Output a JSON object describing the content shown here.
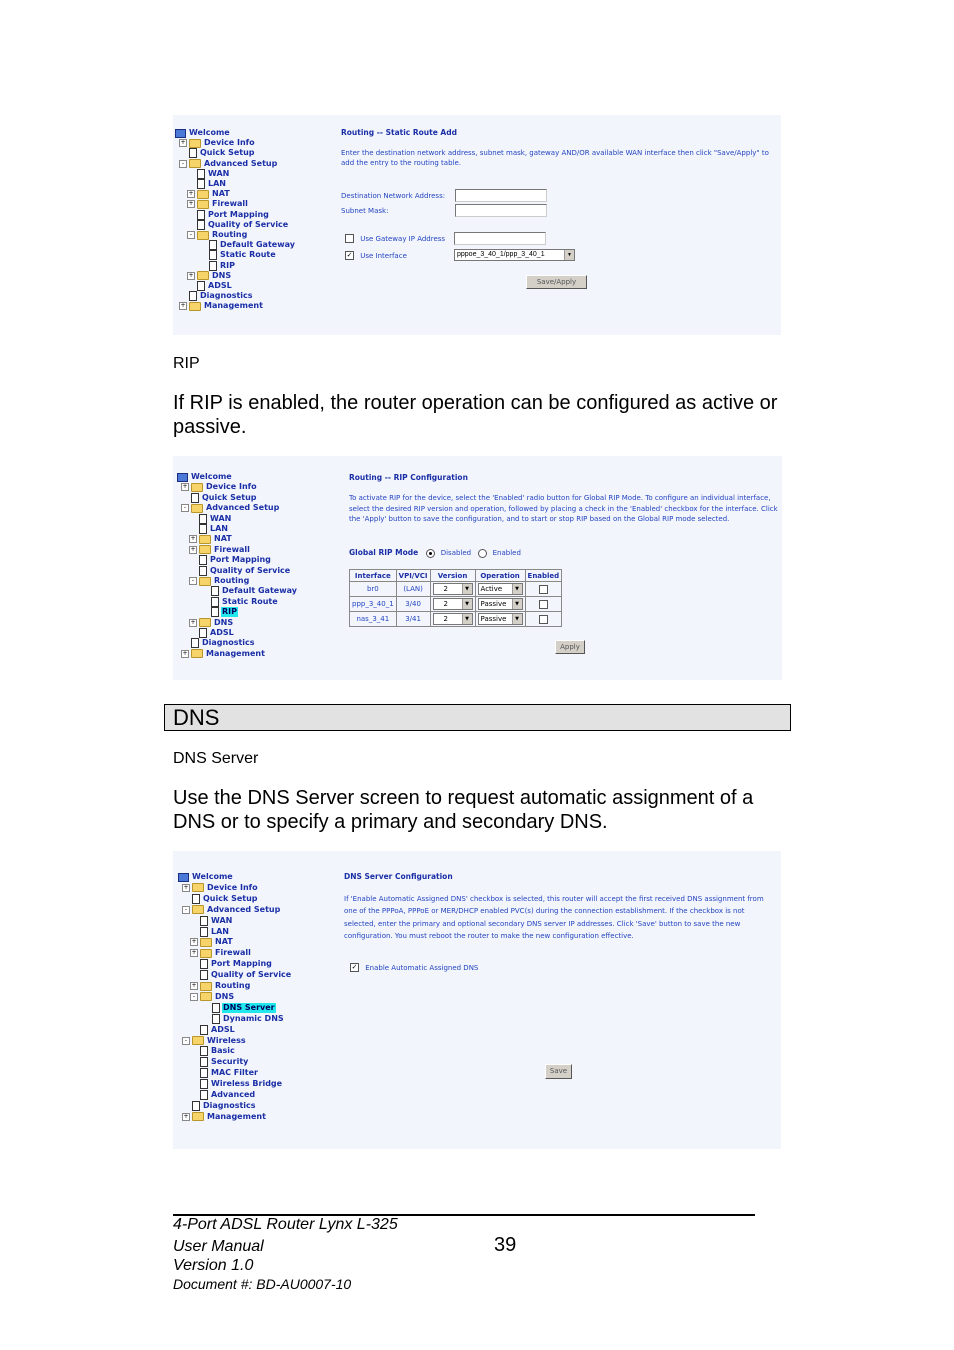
{
  "screenshot1": {
    "tree": [
      {
        "label": "Welcome",
        "icon": "monitor-icon",
        "level": 0
      },
      {
        "label": "Device Info",
        "icon": "folder-icon",
        "level": 0,
        "expander": "+"
      },
      {
        "label": "Quick Setup",
        "icon": "page-icon",
        "level": 0
      },
      {
        "label": "Advanced Setup",
        "icon": "folder-open-icon",
        "level": 0,
        "expander": "-"
      },
      {
        "label": "WAN",
        "icon": "page-icon",
        "level": 1
      },
      {
        "label": "LAN",
        "icon": "page-icon",
        "level": 1
      },
      {
        "label": "NAT",
        "icon": "folder-icon",
        "level": 1,
        "expander": "+"
      },
      {
        "label": "Firewall",
        "icon": "folder-icon",
        "level": 1,
        "expander": "+"
      },
      {
        "label": "Port Mapping",
        "icon": "page-icon",
        "level": 1
      },
      {
        "label": "Quality of Service",
        "icon": "page-icon",
        "level": 1
      },
      {
        "label": "Routing",
        "icon": "folder-open-icon",
        "level": 1,
        "expander": "-"
      },
      {
        "label": "Default Gateway",
        "icon": "page-icon",
        "level": 2
      },
      {
        "label": "Static Route",
        "icon": "page-icon",
        "level": 2
      },
      {
        "label": "RIP",
        "icon": "page-icon",
        "level": 2
      },
      {
        "label": "DNS",
        "icon": "folder-icon",
        "level": 1,
        "expander": "+"
      },
      {
        "label": "ADSL",
        "icon": "page-icon",
        "level": 1
      },
      {
        "label": "Diagnostics",
        "icon": "page-icon",
        "level": 0
      },
      {
        "label": "Management",
        "icon": "folder-icon",
        "level": 0,
        "expander": "+"
      }
    ],
    "title": "Routing -- Static Route Add",
    "description": "Enter the destination network address, subnet mask, gateway AND/OR available WAN interface then click \"Save/Apply\" to add the entry to the routing table.",
    "dest_label": "Destination Network Address:",
    "dest_value": "",
    "mask_label": "Subnet Mask:",
    "mask_value": "",
    "gateway_label": "Use Gateway IP Address",
    "gateway_checked": false,
    "gateway_value": "",
    "interface_label": "Use Interface",
    "interface_checked": true,
    "interface_value": "pppoe_3_40_1/ppp_3_40_1",
    "save_button": "Save/Apply"
  },
  "rip_heading": "RIP",
  "rip_paragraph": "If RIP is enabled, the router operation can be configured as active or passive.",
  "screenshot2": {
    "tree": [
      {
        "label": "Welcome",
        "icon": "monitor-icon",
        "level": 0
      },
      {
        "label": "Device Info",
        "icon": "folder-icon",
        "level": 0,
        "expander": "+"
      },
      {
        "label": "Quick Setup",
        "icon": "page-icon",
        "level": 0
      },
      {
        "label": "Advanced Setup",
        "icon": "folder-open-icon",
        "level": 0,
        "expander": "-"
      },
      {
        "label": "WAN",
        "icon": "page-icon",
        "level": 1
      },
      {
        "label": "LAN",
        "icon": "page-icon",
        "level": 1
      },
      {
        "label": "NAT",
        "icon": "folder-icon",
        "level": 1,
        "expander": "+"
      },
      {
        "label": "Firewall",
        "icon": "folder-icon",
        "level": 1,
        "expander": "+"
      },
      {
        "label": "Port Mapping",
        "icon": "page-icon",
        "level": 1
      },
      {
        "label": "Quality of Service",
        "icon": "page-icon",
        "level": 1
      },
      {
        "label": "Routing",
        "icon": "folder-open-icon",
        "level": 1,
        "expander": "-"
      },
      {
        "label": "Default Gateway",
        "icon": "page-icon",
        "level": 2
      },
      {
        "label": "Static Route",
        "icon": "page-icon",
        "level": 2
      },
      {
        "label": "RIP",
        "icon": "page-icon",
        "level": 2,
        "selected": true
      },
      {
        "label": "DNS",
        "icon": "folder-icon",
        "level": 1,
        "expander": "+"
      },
      {
        "label": "ADSL",
        "icon": "page-icon",
        "level": 1
      },
      {
        "label": "Diagnostics",
        "icon": "page-icon",
        "level": 0
      },
      {
        "label": "Management",
        "icon": "folder-icon",
        "level": 0,
        "expander": "+"
      }
    ],
    "title": "Routing -- RIP Configuration",
    "description": "To activate RIP for the device, select the 'Enabled' radio button for Global RIP Mode. To configure an individual interface, select the desired RIP version and operation, followed by placing a check in the 'Enabled' checkbox for the interface. Click the 'Apply' button to save the configuration, and to start or stop RIP based on the Global RIP mode selected.",
    "global_mode_label": "Global RIP Mode",
    "mode_disabled": "Disabled",
    "mode_enabled": "Enabled",
    "mode_selected": "Disabled",
    "table_headers": [
      "Interface",
      "VPI/VCI",
      "Version",
      "Operation",
      "Enabled"
    ],
    "rows": [
      {
        "interface": "br0",
        "vpivci": "(LAN)",
        "version": "2",
        "operation": "Active",
        "enabled": false
      },
      {
        "interface": "ppp_3_40_1",
        "vpivci": "3/40",
        "version": "2",
        "operation": "Passive",
        "enabled": false
      },
      {
        "interface": "nas_3_41",
        "vpivci": "3/41",
        "version": "2",
        "operation": "Passive",
        "enabled": false
      }
    ],
    "apply_button": "Apply"
  },
  "section_title": "DNS",
  "dns_heading": "DNS Server",
  "dns_paragraph": "Use the DNS Server screen to request automatic assignment of a DNS or to specify a primary and secondary DNS.",
  "screenshot3": {
    "tree": [
      {
        "label": "Welcome",
        "icon": "monitor-icon",
        "level": 0
      },
      {
        "label": "Device Info",
        "icon": "folder-icon",
        "level": 0,
        "expander": "+"
      },
      {
        "label": "Quick Setup",
        "icon": "page-icon",
        "level": 0
      },
      {
        "label": "Advanced Setup",
        "icon": "folder-open-icon",
        "level": 0,
        "expander": "-"
      },
      {
        "label": "WAN",
        "icon": "page-icon",
        "level": 1
      },
      {
        "label": "LAN",
        "icon": "page-icon",
        "level": 1
      },
      {
        "label": "NAT",
        "icon": "folder-icon",
        "level": 1,
        "expander": "+"
      },
      {
        "label": "Firewall",
        "icon": "folder-icon",
        "level": 1,
        "expander": "+"
      },
      {
        "label": "Port Mapping",
        "icon": "page-icon",
        "level": 1
      },
      {
        "label": "Quality of Service",
        "icon": "page-icon",
        "level": 1
      },
      {
        "label": "Routing",
        "icon": "folder-icon",
        "level": 1,
        "expander": "+"
      },
      {
        "label": "DNS",
        "icon": "folder-open-icon",
        "level": 1,
        "expander": "-"
      },
      {
        "label": "DNS Server",
        "icon": "page-icon",
        "level": 2,
        "selected": true
      },
      {
        "label": "Dynamic DNS",
        "icon": "page-icon",
        "level": 2
      },
      {
        "label": "ADSL",
        "icon": "page-icon",
        "level": 1
      },
      {
        "label": "Wireless",
        "icon": "folder-open-icon",
        "level": 0,
        "expander": "-"
      },
      {
        "label": "Basic",
        "icon": "page-icon",
        "level": 1
      },
      {
        "label": "Security",
        "icon": "page-icon",
        "level": 1
      },
      {
        "label": "MAC Filter",
        "icon": "page-icon",
        "level": 1
      },
      {
        "label": "Wireless Bridge",
        "icon": "page-icon",
        "level": 1
      },
      {
        "label": "Advanced",
        "icon": "page-icon",
        "level": 1
      },
      {
        "label": "Diagnostics",
        "icon": "page-icon",
        "level": 0
      },
      {
        "label": "Management",
        "icon": "folder-icon",
        "level": 0,
        "expander": "+"
      }
    ],
    "title": "DNS Server Configuration",
    "description": "If 'Enable Automatic Assigned DNS' checkbox is selected, this router will accept the first received DNS assignment from one of the PPPoA, PPPoE or MER/DHCP enabled PVC(s) during the connection establishment. If the checkbox is not selected, enter the primary and optional secondary DNS server IP addresses. Click 'Save' button to save the new configuration. You must reboot the router to make the new configuration effective.",
    "auto_dns_label": "Enable Automatic Assigned DNS",
    "auto_dns_checked": true,
    "save_button": "Save"
  },
  "footer": {
    "product": "4-Port ADSL Router Lynx L-325",
    "manual": "User Manual",
    "version": "Version 1.0",
    "document": "Document #:  BD-AU0007-10",
    "page_number": "39"
  },
  "colors": {
    "link_blue": "#1a2fa6",
    "selected_highlight": "#22e8ec",
    "screenshot_bg": "#f3f5fd",
    "section_bar_bg": "#e2e2e2"
  }
}
